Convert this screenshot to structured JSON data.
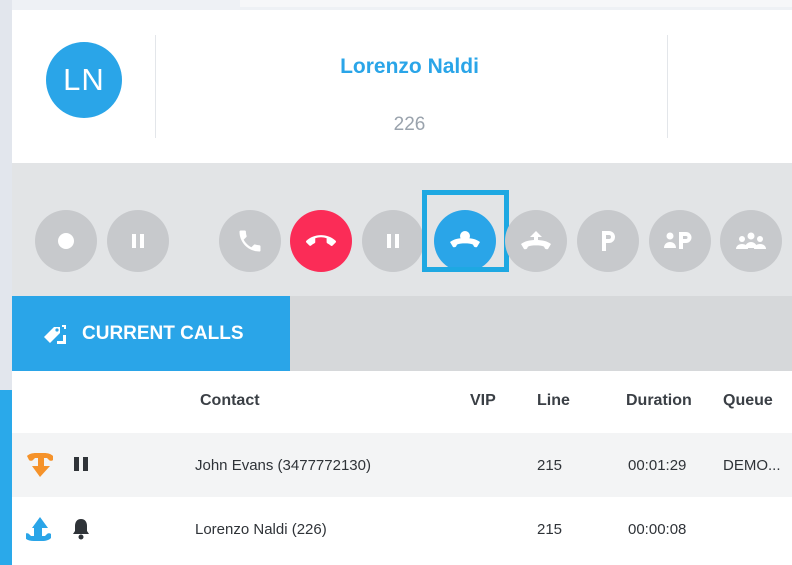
{
  "contact": {
    "initials": "LN",
    "name": "Lorenzo Naldi",
    "extension": "226"
  },
  "controls": [
    {
      "name": "record-button",
      "icon": "record-icon",
      "state": "disabled"
    },
    {
      "name": "pause-record-button",
      "icon": "pause-icon",
      "state": "disabled"
    },
    {
      "name": "call-button",
      "icon": "phone-icon",
      "state": "disabled"
    },
    {
      "name": "hangup-button",
      "icon": "hangup-icon",
      "state": "active",
      "color": "#fb2c57"
    },
    {
      "name": "hold-button",
      "icon": "pause-icon",
      "state": "disabled"
    },
    {
      "name": "transfer-button",
      "icon": "transfer-icon",
      "state": "selected",
      "color": "#2aa5e8"
    },
    {
      "name": "pickup-button",
      "icon": "pickup-icon",
      "state": "disabled"
    },
    {
      "name": "park-button",
      "icon": "park-icon",
      "label": "P",
      "state": "disabled"
    },
    {
      "name": "user-park-button",
      "icon": "user-park-icon",
      "label": "P",
      "state": "disabled"
    },
    {
      "name": "conference-button",
      "icon": "conference-icon",
      "state": "disabled"
    }
  ],
  "tabs": {
    "current_calls": "CURRENT CALLS"
  },
  "table": {
    "headers": [
      "Contact",
      "VIP",
      "Line",
      "Duration",
      "Queue"
    ],
    "rows": [
      {
        "direction": "incoming",
        "direction_color": "#f5922a",
        "status_icon": "pause-icon",
        "contact": "John Evans (3477772130)",
        "vip": "",
        "line": "215",
        "duration": "00:01:29",
        "queue": "DEMO..."
      },
      {
        "direction": "outgoing",
        "direction_color": "#2aa5e8",
        "status_icon": "bell-icon",
        "contact": "Lorenzo Naldi (226)",
        "vip": "",
        "line": "215",
        "duration": "00:00:08",
        "queue": ""
      }
    ]
  },
  "colors": {
    "accent": "#2aa5e8",
    "hangup": "#fb2c57",
    "disabled": "#c7c9cc"
  }
}
